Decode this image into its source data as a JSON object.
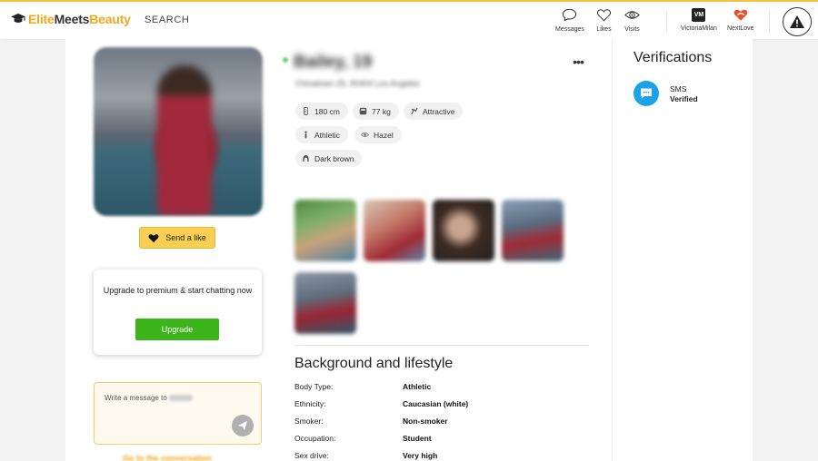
{
  "brand": {
    "part1": "Elite",
    "part2": "Meets",
    "part3": "Beauty",
    "accent": "#f0a81c"
  },
  "header": {
    "search_label": "SEARCH",
    "nav": [
      {
        "label": "Messages",
        "icon": "chat-bubble-icon"
      },
      {
        "label": "Likes",
        "icon": "heart-outline-icon"
      },
      {
        "label": "Visits",
        "icon": "eye-icon"
      }
    ],
    "partners": [
      {
        "label": "VictoriaMilan",
        "badge": "VM"
      },
      {
        "label": "NextLove",
        "icon": "nextlove-logo-icon"
      }
    ],
    "report_icon": "warning-triangle-icon"
  },
  "profile": {
    "name_blurred": "Bailey, 19",
    "subtitle_blurred": "Chinatown 25, 90404 Los Angeles",
    "tags": [
      {
        "label": "180 cm",
        "icon": "height-icon"
      },
      {
        "label": "77 kg",
        "icon": "scale-icon"
      },
      {
        "label": "Attractive",
        "icon": "sparkle-icon"
      },
      {
        "label": "Athletic",
        "icon": "body-icon"
      },
      {
        "label": "Hazel",
        "icon": "eye-icon"
      },
      {
        "label": "Dark brown",
        "icon": "hair-icon"
      }
    ],
    "more_label": "•••"
  },
  "actions": {
    "like_label": "Send a like",
    "upgrade_text": "Upgrade to premium & start chatting now",
    "upgrade_button": "Upgrade",
    "message_placeholder": "Write a message to",
    "goto_conversation_blurred": "Go to the conversation"
  },
  "lifestyle": {
    "title": "Background and lifestyle",
    "rows": [
      {
        "label": "Body Type:",
        "value": "Athletic"
      },
      {
        "label": "Ethnicity:",
        "value": "Caucasian (white)"
      },
      {
        "label": "Smoker:",
        "value": "Non-smoker"
      },
      {
        "label": "Occupation:",
        "value": "Student"
      },
      {
        "label": "Sex drive:",
        "value": "Very high"
      }
    ]
  },
  "verifications": {
    "title": "Verifications",
    "items": [
      {
        "name": "SMS",
        "status": "Verified",
        "icon": "sms-icon",
        "color": "#1aa3e8"
      }
    ]
  },
  "colors": {
    "like_button": "#f8cf52",
    "upgrade_button": "#3cb51b",
    "header_accent": "#f5c242"
  }
}
